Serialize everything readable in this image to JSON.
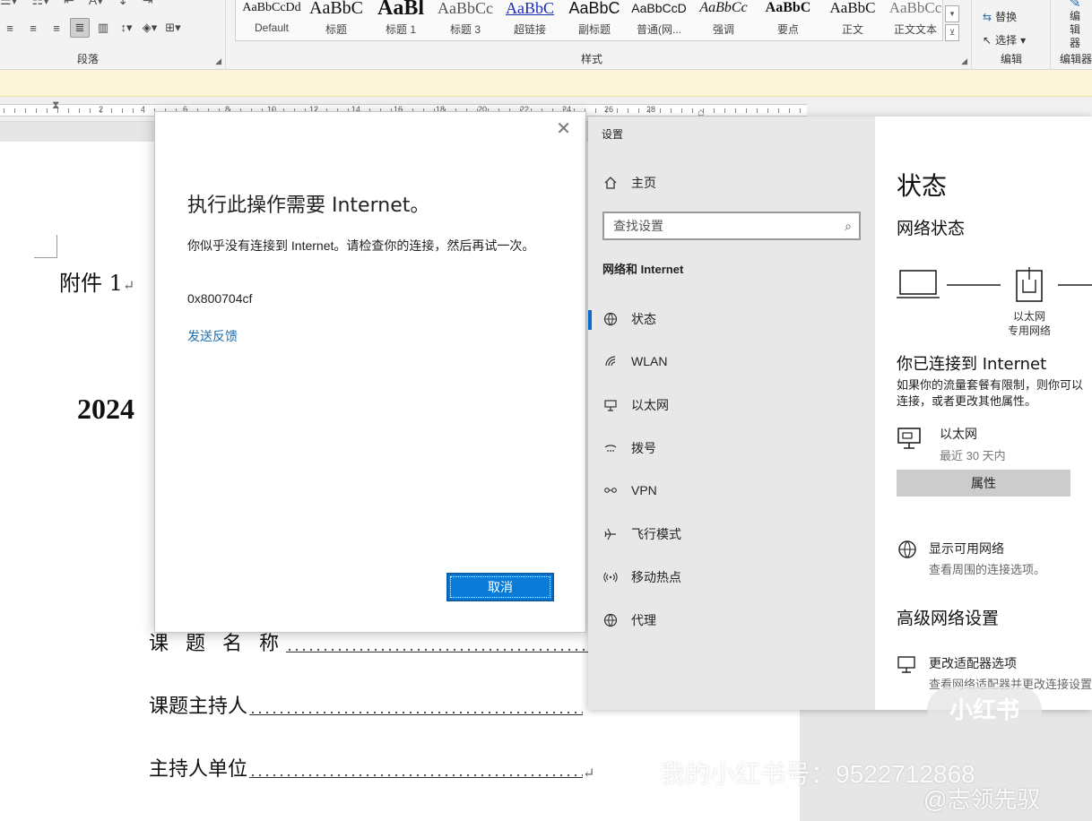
{
  "ribbon": {
    "paragraph_label": "段落",
    "styles_label": "样式",
    "editing_label": "编辑",
    "editor_label": "编辑器",
    "editor_btn": "编辑器",
    "replace": "替换",
    "select": "选择",
    "styles": [
      {
        "sample": "AaBbCcDd",
        "name": "Default"
      },
      {
        "sample": "AaBbC",
        "name": "标题"
      },
      {
        "sample": "AaBl",
        "name": "标题 1"
      },
      {
        "sample": "AaBbCc",
        "name": "标题 3"
      },
      {
        "sample": "AaBbC",
        "name": "超链接"
      },
      {
        "sample": "AaBbC",
        "name": "副标题"
      },
      {
        "sample": "AaBbCcD",
        "name": "普通(网..."
      },
      {
        "sample": "AaBbCc",
        "name": "强调"
      },
      {
        "sample": "AaBbC",
        "name": "要点"
      },
      {
        "sample": "AaBbC",
        "name": "正文"
      },
      {
        "sample": "AaBbCc",
        "name": "正文文本"
      }
    ]
  },
  "ruler": {
    "numbers": [
      "2",
      "4",
      "6",
      "8",
      "10",
      "12",
      "14",
      "16",
      "18",
      "20",
      "22",
      "24",
      "26",
      "28"
    ]
  },
  "document": {
    "attachment": "附件 1",
    "year": "2024",
    "fields": [
      "课 题 名 称",
      "课题主持人",
      "主持人单位"
    ]
  },
  "dialog": {
    "title": "执行此操作需要 Internet。",
    "body": "你似乎没有连接到 Internet。请检查你的连接，然后再试一次。",
    "code": "0x800704cf",
    "feedback": "发送反馈",
    "cancel": "取消"
  },
  "settings": {
    "caption": "设置",
    "home": "主页",
    "search_placeholder": "查找设置",
    "section": "网络和 Internet",
    "nav": [
      {
        "label": "状态",
        "icon": "globe-status-icon"
      },
      {
        "label": "WLAN",
        "icon": "wifi-icon"
      },
      {
        "label": "以太网",
        "icon": "ethernet-icon"
      },
      {
        "label": "拨号",
        "icon": "dialup-icon"
      },
      {
        "label": "VPN",
        "icon": "vpn-icon"
      },
      {
        "label": "飞行模式",
        "icon": "airplane-icon"
      },
      {
        "label": "移动热点",
        "icon": "hotspot-icon"
      },
      {
        "label": "代理",
        "icon": "globe-icon"
      }
    ],
    "content": {
      "title": "状态",
      "network_status": "网络状态",
      "diagram_label1": "以太网",
      "diagram_label2": "专用网络",
      "connected": "你已连接到 Internet",
      "desc_line1": "如果你的流量套餐有限制，则你可以",
      "desc_line2": "连接，或者更改其他属性。",
      "eth_name": "以太网",
      "eth_sub": "最近 30 天内",
      "properties": "属性",
      "show_networks": "显示可用网络",
      "show_networks_desc": "查看周围的连接选项。",
      "advanced": "高级网络设置",
      "adapter": "更改适配器选项",
      "adapter_desc": "查看网络适配器并更改连接设置"
    }
  },
  "watermark": {
    "logo": "小红书",
    "id_text": "我的小红书号：9522712868",
    "weibo": "@志领先驭"
  },
  "colors": {
    "accent": "#0a7bd7",
    "link": "#1a6fb4",
    "infobar": "#fdf5d8",
    "nav_bg": "#e8e8e8"
  }
}
